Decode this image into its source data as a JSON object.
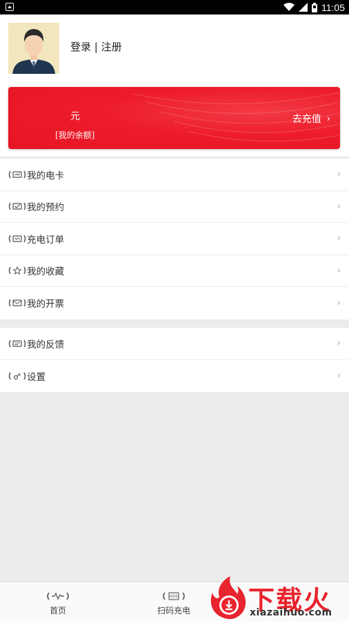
{
  "status_bar": {
    "time": "11:05",
    "icons": [
      "notification-icon",
      "wifi-icon",
      "signal-icon",
      "battery-icon"
    ]
  },
  "profile": {
    "avatar_icon": "user-avatar-icon",
    "login_label": "登录 | 注册"
  },
  "balance_card": {
    "unit": "元",
    "label": "[我的余额]",
    "recharge_label": "去充值",
    "recharge_icon": "chevron-right-icon",
    "color": "#ed1c2b"
  },
  "menu_group_1": [
    {
      "label": "我的电卡",
      "icon": "card-icon"
    },
    {
      "label": "我的预约",
      "icon": "reservation-icon"
    },
    {
      "label": "充电订单",
      "icon": "order-icon"
    },
    {
      "label": "我的收藏",
      "icon": "star-icon"
    },
    {
      "label": "我的开票",
      "icon": "invoice-icon"
    }
  ],
  "menu_group_2": [
    {
      "label": "我的反馈",
      "icon": "feedback-icon"
    },
    {
      "label": "设置",
      "icon": "settings-icon"
    }
  ],
  "tabbar": {
    "tabs": [
      {
        "label": "首页",
        "icon": "home-icon"
      },
      {
        "label": "扫码充电",
        "icon": "scan-icon"
      }
    ]
  },
  "watermark": {
    "title": "下载火",
    "subtitle": "xiazaihuo.com"
  },
  "colors": {
    "accent": "#ed1c2b",
    "background": "#ececec"
  }
}
